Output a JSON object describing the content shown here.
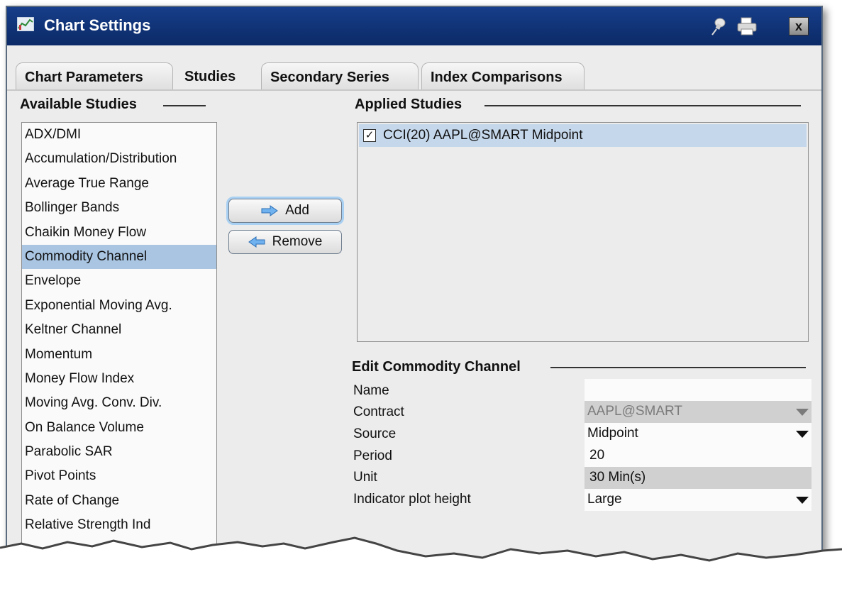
{
  "window": {
    "title": "Chart Settings"
  },
  "title_icons": [
    "pin-icon",
    "printer-icon",
    "close-icon"
  ],
  "close_label": "x",
  "tabs": [
    {
      "label": "Chart Parameters",
      "active": false
    },
    {
      "label": "Studies",
      "active": true
    },
    {
      "label": "Secondary Series",
      "active": false
    },
    {
      "label": "Index Comparisons",
      "active": false
    }
  ],
  "available": {
    "heading": "Available Studies",
    "items": [
      "ADX/DMI",
      "Accumulation/Distribution",
      "Average True Range",
      "Bollinger Bands",
      "Chaikin Money Flow",
      "Commodity Channel",
      "Envelope",
      "Exponential Moving Avg.",
      "Keltner Channel",
      "Momentum",
      "Money Flow Index",
      "Moving Avg. Conv. Div.",
      "On Balance Volume",
      "Parabolic SAR",
      "Pivot Points",
      "Rate of Change",
      "Relative Strength Ind"
    ],
    "selected": "Commodity Channel"
  },
  "buttons": {
    "add": "Add",
    "remove": "Remove"
  },
  "applied": {
    "heading": "Applied Studies",
    "items": [
      {
        "label": "CCI(20) AAPL@SMART Midpoint",
        "checked": true
      }
    ]
  },
  "edit": {
    "heading": "Edit Commodity Channel",
    "fields": {
      "name": {
        "label": "Name",
        "value": ""
      },
      "contract": {
        "label": "Contract",
        "value": "AAPL@SMART"
      },
      "source": {
        "label": "Source",
        "value": "Midpoint"
      },
      "period": {
        "label": "Period",
        "value": "20"
      },
      "unit": {
        "label": "Unit",
        "value": "30 Min(s)"
      },
      "plot_height": {
        "label": "Indicator plot height",
        "value": "Large"
      }
    }
  },
  "colors": {
    "titlebar": "#173e8a",
    "selection": "#a9c5e2",
    "applied_selection": "#c5d7ea"
  }
}
